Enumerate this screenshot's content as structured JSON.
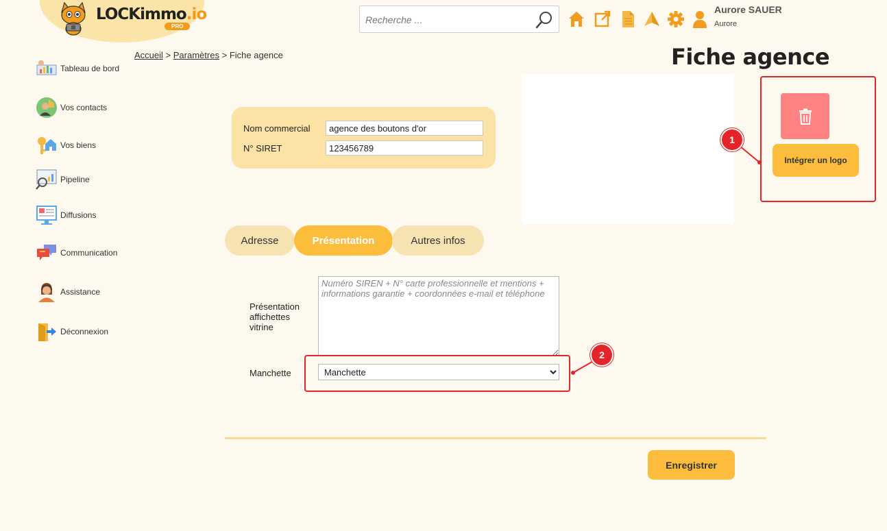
{
  "brand": {
    "name": "LOCKimmo",
    "suffix": ".io",
    "badge": "PRO"
  },
  "search": {
    "placeholder": "Recherche ..."
  },
  "header_icons": [
    "home-icon",
    "external-link-icon",
    "document-icon",
    "paper-plane-icon",
    "gear-icon",
    "user-icon"
  ],
  "user": {
    "name": "Aurore SAUER",
    "sub": "Aurore"
  },
  "sidebar": {
    "items": [
      {
        "label": "Tableau de bord",
        "icon": "dashboard-icon"
      },
      {
        "label": "Vos contacts",
        "icon": "contacts-icon"
      },
      {
        "label": "Vos biens",
        "icon": "property-key-icon"
      },
      {
        "label": "Pipeline",
        "icon": "pipeline-icon"
      },
      {
        "label": "Diffusions",
        "icon": "broadcast-icon"
      },
      {
        "label": "Communication",
        "icon": "chat-bubbles-icon"
      },
      {
        "label": "Assistance",
        "icon": "support-agent-icon"
      },
      {
        "label": "Déconnexion",
        "icon": "logout-icon"
      }
    ]
  },
  "breadcrumb": {
    "home": "Accueil",
    "sep1": ">",
    "settings": "Paramètres",
    "sep2": ">",
    "current": "Fiche agence"
  },
  "page": {
    "title": "Fiche agence"
  },
  "identity": {
    "commercial_name_label": "Nom commercial",
    "commercial_name_value": "agence des boutons d'or",
    "siret_label": "N° SIRET",
    "siret_value": "123456789"
  },
  "logo_actions": {
    "integrate_label": "Intégrer un logo",
    "delete_icon": "trash-icon"
  },
  "annotations": [
    "1",
    "2"
  ],
  "tabs": [
    {
      "label": "Adresse",
      "active": false
    },
    {
      "label": "Présentation",
      "active": true
    },
    {
      "label": "Autres infos",
      "active": false
    }
  ],
  "presentation": {
    "label": "Présentation affichettes vitrine",
    "placeholder": "Numéro SIREN + N° carte professionnelle et mentions + informations garantie + coordonnées e-mail et téléphone",
    "manchette_label": "Manchette",
    "manchette_value": "Manchette"
  },
  "footer": {
    "save_label": "Enregistrer"
  },
  "colors": {
    "accent": "#fdbd3c",
    "danger": "#ff8282",
    "annotation": "#e5242a",
    "background": "#fdf9ef",
    "card": "#fbe3a6"
  }
}
